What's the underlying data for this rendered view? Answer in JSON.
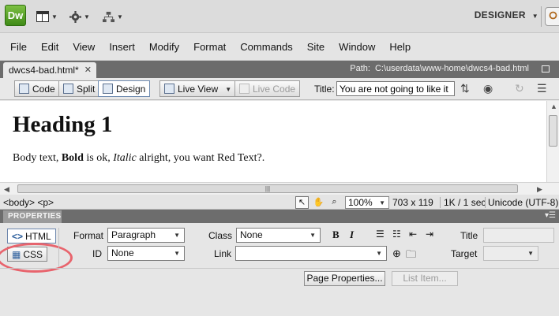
{
  "app": {
    "logo_text": "Dw",
    "workspace": "DESIGNER",
    "tools": [
      "layout-icon",
      "gear-icon",
      "site-icon"
    ]
  },
  "menu": [
    "File",
    "Edit",
    "View",
    "Insert",
    "Modify",
    "Format",
    "Commands",
    "Site",
    "Window",
    "Help"
  ],
  "document": {
    "tab_name": "dwcs4-bad.html*",
    "path_label": "Path:",
    "path": "C:\\userdata\\www-home\\dwcs4-bad.html"
  },
  "doc_toolbar": {
    "code": "Code",
    "split": "Split",
    "design": "Design",
    "live_view": "Live View",
    "live_code": "Live Code",
    "title_label": "Title:",
    "title_value": "You are not going to like it"
  },
  "content": {
    "heading": "Heading 1",
    "body_before": "Body text, ",
    "bold": "Bold",
    "is_ok": " is ok, ",
    "italic": "Italic",
    "after": " alright, you want Red Text?."
  },
  "status": {
    "tags": "<body> <p>",
    "zoom": "100%",
    "size": "703 x 119",
    "download": "1K / 1 sec",
    "encoding": "Unicode (UTF-8)"
  },
  "properties": {
    "panel_title": "PROPERTIES",
    "html_btn": "HTML",
    "css_btn": "CSS",
    "format_label": "Format",
    "format_value": "Paragraph",
    "id_label": "ID",
    "id_value": "None",
    "class_label": "Class",
    "class_value": "None",
    "link_label": "Link",
    "link_value": "",
    "bold_btn": "B",
    "italic_btn": "I",
    "title_label": "Title",
    "target_label": "Target",
    "page_properties": "Page Properties...",
    "list_item": "List Item..."
  },
  "colors": {
    "highlight": "#e8646d",
    "logo": "#4f9a20"
  }
}
